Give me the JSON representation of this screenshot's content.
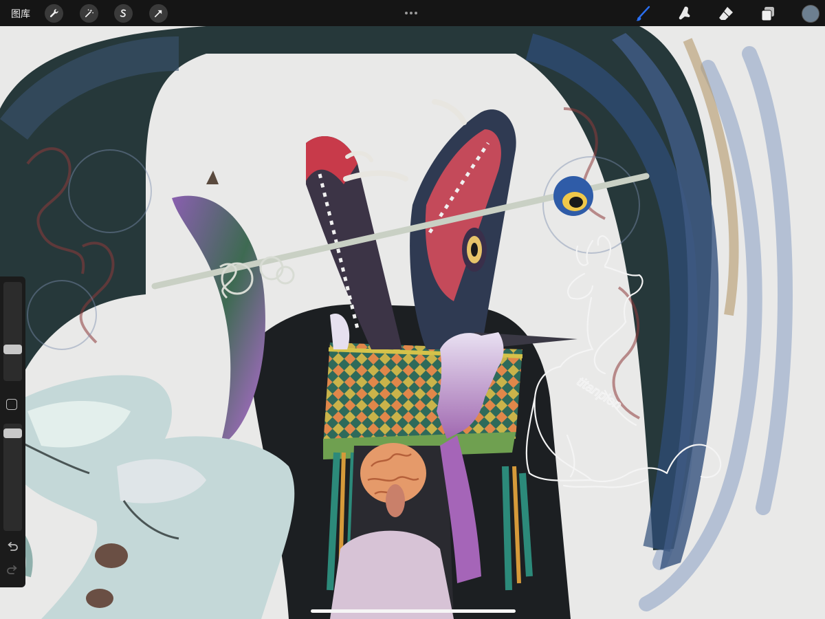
{
  "toolbar": {
    "gallery_label": "图库",
    "left_tools": [
      "wrench-icon",
      "magic-wand-icon",
      "selection-s-icon",
      "transform-arrow-icon"
    ],
    "right_tools": [
      "brush-icon",
      "smudge-icon",
      "eraser-icon",
      "layers-icon"
    ],
    "active_tool": "brush-icon",
    "accent_color": "#2a6ff0",
    "current_color": "#6d7f90"
  },
  "sidebar": {
    "brush_size_level": 0.3,
    "opacity_level": 0.95,
    "controls": [
      "brush-size-slider",
      "modify-button",
      "opacity-slider",
      "undo-icon",
      "redo-icon"
    ]
  },
  "canvas": {
    "sketch_signature": "titanplon"
  }
}
